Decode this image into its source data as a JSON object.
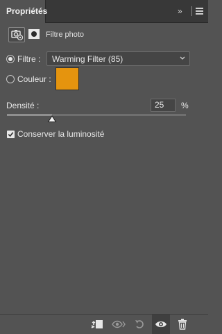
{
  "panel": {
    "tab_title": "Propriétés",
    "collapse_glyph": "»",
    "menu_icon": "menu-icon"
  },
  "header": {
    "adjustment_icon": "photo-filter-adjustment-icon",
    "mask_icon": "layer-mask-icon",
    "title": "Filtre photo"
  },
  "filter_option": {
    "label": "Filtre :",
    "selected": true,
    "value": "Warming Filter (85)"
  },
  "color_option": {
    "label": "Couleur :",
    "selected": false,
    "swatch_color": "#e5940e"
  },
  "density": {
    "label": "Densité :",
    "value": "25",
    "unit": "%",
    "slider_percent": 25
  },
  "preserve_luminosity": {
    "label": "Conserver la luminosité",
    "checked": true
  },
  "bottom_toolbar": {
    "clip_icon": "clip-to-layer-icon",
    "view_previous_icon": "view-previous-state-icon",
    "reset_icon": "reset-defaults-icon",
    "visibility_icon": "eye-icon",
    "delete_icon": "trash-icon"
  }
}
